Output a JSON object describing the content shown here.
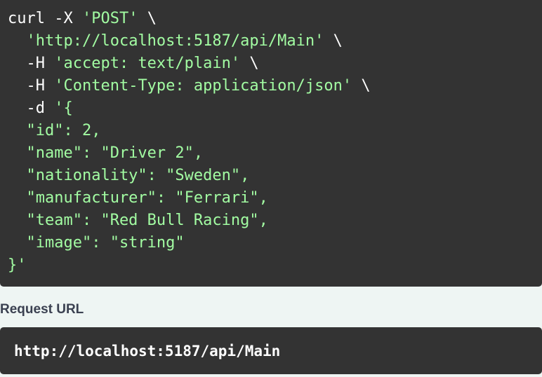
{
  "curl_code": {
    "lines": [
      [
        {
          "t": "plain",
          "v": "curl -X "
        },
        {
          "t": "str",
          "v": "'POST'"
        },
        {
          "t": "plain",
          "v": " \\"
        }
      ],
      [
        {
          "t": "plain",
          "v": "  "
        },
        {
          "t": "str",
          "v": "'http://localhost:5187/api/Main'"
        },
        {
          "t": "plain",
          "v": " \\"
        }
      ],
      [
        {
          "t": "plain",
          "v": "  -H "
        },
        {
          "t": "str",
          "v": "'accept: text/plain'"
        },
        {
          "t": "plain",
          "v": " \\"
        }
      ],
      [
        {
          "t": "plain",
          "v": "  -H "
        },
        {
          "t": "str",
          "v": "'Content-Type: application/json'"
        },
        {
          "t": "plain",
          "v": " \\"
        }
      ],
      [
        {
          "t": "plain",
          "v": "  -d "
        },
        {
          "t": "str",
          "v": "'{"
        }
      ],
      [
        {
          "t": "str",
          "v": "  \"id\": 2,"
        }
      ],
      [
        {
          "t": "str",
          "v": "  \"name\": \"Driver 2\","
        }
      ],
      [
        {
          "t": "str",
          "v": "  \"nationality\": \"Sweden\","
        }
      ],
      [
        {
          "t": "str",
          "v": "  \"manufacturer\": \"Ferrari\","
        }
      ],
      [
        {
          "t": "str",
          "v": "  \"team\": \"Red Bull Racing\","
        }
      ],
      [
        {
          "t": "str",
          "v": "  \"image\": \"string\""
        }
      ],
      [
        {
          "t": "str",
          "v": "}'"
        }
      ]
    ]
  },
  "request_url": {
    "label": "Request URL",
    "value": "http://localhost:5187/api/Main"
  },
  "colors": {
    "code_background": "#333333",
    "string_token": "#a2fca2",
    "plain_token": "#ffffff",
    "page_background": "#eef5f3",
    "label_text": "#3b4151"
  }
}
